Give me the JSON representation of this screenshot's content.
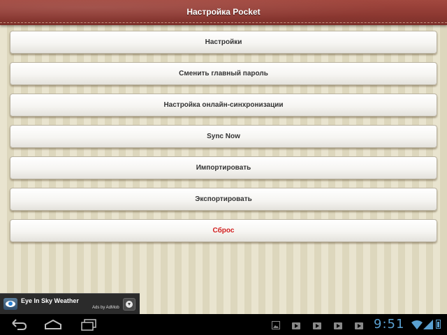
{
  "app": {
    "title": "Настройка Pocket"
  },
  "menu": [
    {
      "id": "settings",
      "label": "Настройки"
    },
    {
      "id": "change-master-password",
      "label": "Сменить главный пароль"
    },
    {
      "id": "online-sync-settings",
      "label": "Настройка онлайн-синхронизации"
    },
    {
      "id": "sync-now",
      "label": "Sync Now"
    },
    {
      "id": "import",
      "label": "Импортировать"
    },
    {
      "id": "export",
      "label": "Экспортировать"
    },
    {
      "id": "reset",
      "label": "Сброс",
      "color": "#d21e1e"
    }
  ],
  "ad": {
    "title": "Eye In Sky Weather",
    "subtitle": "Ads by AdMob",
    "icon": "eye-logo-icon",
    "action_icon": "download-icon"
  },
  "statusbar": {
    "time": "9:51",
    "notifications": [
      "image-icon",
      "play-store-icon",
      "play-store-icon",
      "play-store-icon",
      "play-store-icon"
    ],
    "icons": [
      "wifi-icon",
      "signal-icon",
      "battery-icon"
    ],
    "accent": "#5aa0d0"
  },
  "theme": {
    "title_bar": "#8f3a33",
    "background": "#e9e4cf",
    "danger": "#d21e1e"
  }
}
